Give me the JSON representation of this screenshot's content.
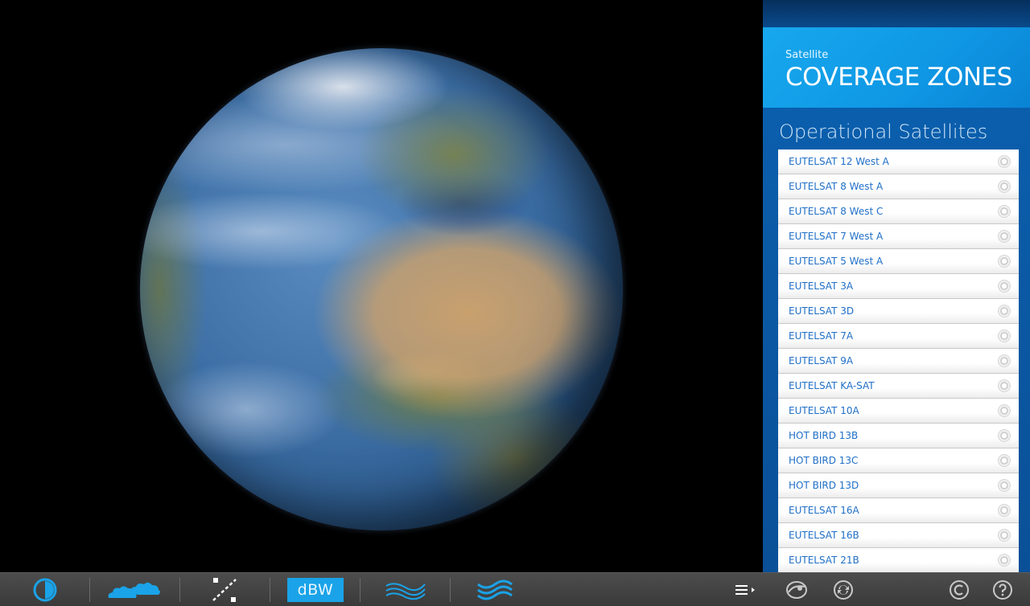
{
  "panel": {
    "header_sub": "Satellite",
    "header_title": "COVERAGE ZONES",
    "list_title": "Operational Satellites",
    "satellites": [
      "EUTELSAT 12 West A",
      "EUTELSAT 8 West A",
      "EUTELSAT 8 West C",
      "EUTELSAT 7 West A",
      "EUTELSAT 5 West A",
      "EUTELSAT 3A",
      "EUTELSAT 3D",
      "EUTELSAT 7A",
      "EUTELSAT 9A",
      "EUTELSAT KA-SAT",
      "EUTELSAT 10A",
      "HOT BIRD 13B",
      "HOT BIRD 13C",
      "HOT BIRD 13D",
      "EUTELSAT 16A",
      "EUTELSAT 16B",
      "EUTELSAT 21B"
    ]
  },
  "toolbar": {
    "dbw_label": "dBW",
    "icons": [
      "day-night-icon",
      "clouds-icon",
      "orbit-icon",
      "dbw-icon",
      "waves-icon",
      "waves-icon",
      "menu-icon"
    ]
  },
  "panel_footer": {
    "icons": [
      "globe-icon",
      "refresh-icon",
      "copyright-icon",
      "help-icon"
    ]
  },
  "colors": {
    "accent": "#1aa3e8",
    "panel_bg": "#0a5aa6",
    "list_text": "#1f6fc7",
    "toolbar_bg": "#444444"
  }
}
